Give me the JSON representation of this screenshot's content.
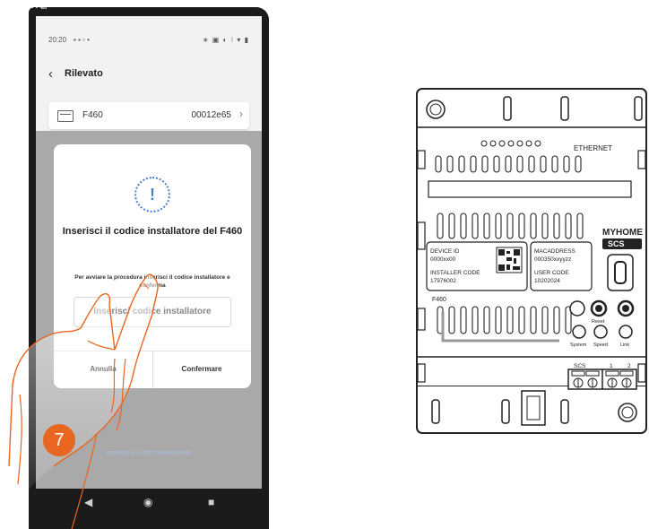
{
  "phone": {
    "status_time": "20:20",
    "nav": {
      "back_icon": "chevron-left-icon",
      "title": "Rilevato"
    },
    "device_row": {
      "name": "F460",
      "id": "00012e65"
    },
    "dialog": {
      "title": "Inserisci il codice installatore del F460",
      "subtitle": "Per avviare la procedura inserisci il codice installatore e conferma",
      "input_placeholder": "Inserisci codice installatore",
      "cancel_label": "Annulla",
      "confirm_label": "Confermare",
      "accent_color": "#4a7fd0"
    },
    "bottom_link": "Inserisci un altro manualmente"
  },
  "step_number": "7",
  "step_color": "#e8661f",
  "device_module": {
    "brand_line1": "MYHOME",
    "brand_line2": "SCS",
    "ethernet_label": "ETHERNET",
    "device_id_label": "DEVICE ID",
    "device_id_value": "0000xx00",
    "installer_code_label": "INSTALLER CODE",
    "installer_code_value": "17976002",
    "macaddress_label": "MACADDRESS",
    "macaddress_value": "000350xxyyzz",
    "user_code_label": "USER CODE",
    "user_code_value": "10202024",
    "model": "F460",
    "button_labels": [
      "Reset",
      "System",
      "Speed",
      "Link"
    ],
    "terminal_labels": [
      "SCS",
      "1",
      "2"
    ]
  }
}
